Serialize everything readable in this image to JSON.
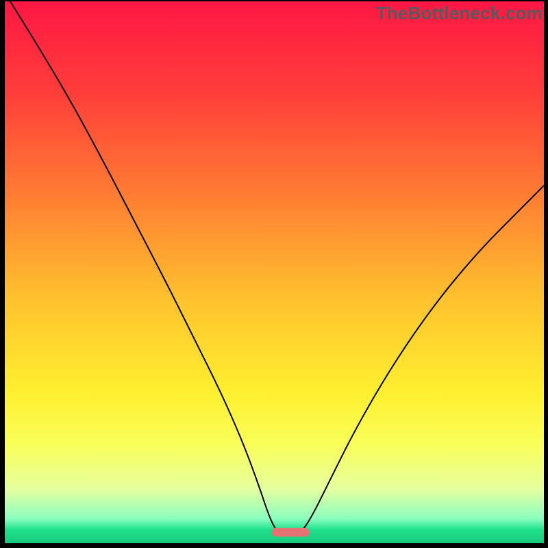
{
  "watermark": "TheBottleneck.com",
  "chart_data": {
    "type": "line",
    "title": "",
    "xlabel": "",
    "ylabel": "",
    "xlim": [
      0,
      100
    ],
    "ylim": [
      0,
      100
    ],
    "grid": false,
    "legend": false,
    "background_gradient": {
      "stops": [
        {
          "offset": 0.0,
          "color": "#ff1744"
        },
        {
          "offset": 0.17,
          "color": "#ff3e3a"
        },
        {
          "offset": 0.35,
          "color": "#ff7a33"
        },
        {
          "offset": 0.55,
          "color": "#ffc22e"
        },
        {
          "offset": 0.72,
          "color": "#ffef2f"
        },
        {
          "offset": 0.82,
          "color": "#f9ff5a"
        },
        {
          "offset": 0.9,
          "color": "#e6ffa0"
        },
        {
          "offset": 0.955,
          "color": "#8affc0"
        },
        {
          "offset": 0.975,
          "color": "#1fe08a"
        },
        {
          "offset": 1.0,
          "color": "#18c97c"
        }
      ]
    },
    "series": [
      {
        "name": "bottleneck-curve",
        "color": "#000000",
        "points": [
          {
            "x": 1.0,
            "y": 100.0
          },
          {
            "x": 6.0,
            "y": 92.0
          },
          {
            "x": 12.0,
            "y": 82.0
          },
          {
            "x": 18.0,
            "y": 71.0
          },
          {
            "x": 24.0,
            "y": 59.5
          },
          {
            "x": 30.0,
            "y": 48.0
          },
          {
            "x": 35.0,
            "y": 38.0
          },
          {
            "x": 40.0,
            "y": 28.0
          },
          {
            "x": 44.0,
            "y": 19.0
          },
          {
            "x": 47.0,
            "y": 11.0
          },
          {
            "x": 49.0,
            "y": 5.0
          },
          {
            "x": 50.5,
            "y": 2.0
          },
          {
            "x": 52.0,
            "y": 2.0
          },
          {
            "x": 53.5,
            "y": 2.0
          },
          {
            "x": 55.0,
            "y": 2.0
          },
          {
            "x": 57.0,
            "y": 5.0
          },
          {
            "x": 60.0,
            "y": 11.0
          },
          {
            "x": 65.0,
            "y": 21.0
          },
          {
            "x": 72.0,
            "y": 33.0
          },
          {
            "x": 80.0,
            "y": 44.5
          },
          {
            "x": 88.0,
            "y": 54.0
          },
          {
            "x": 95.0,
            "y": 61.0
          },
          {
            "x": 100.0,
            "y": 66.0
          }
        ]
      }
    ],
    "marker": {
      "name": "optimal-zone",
      "shape": "pill",
      "color": "#e57373",
      "x_center": 53.0,
      "y": 2.0,
      "width": 7.0,
      "height": 1.6
    }
  }
}
